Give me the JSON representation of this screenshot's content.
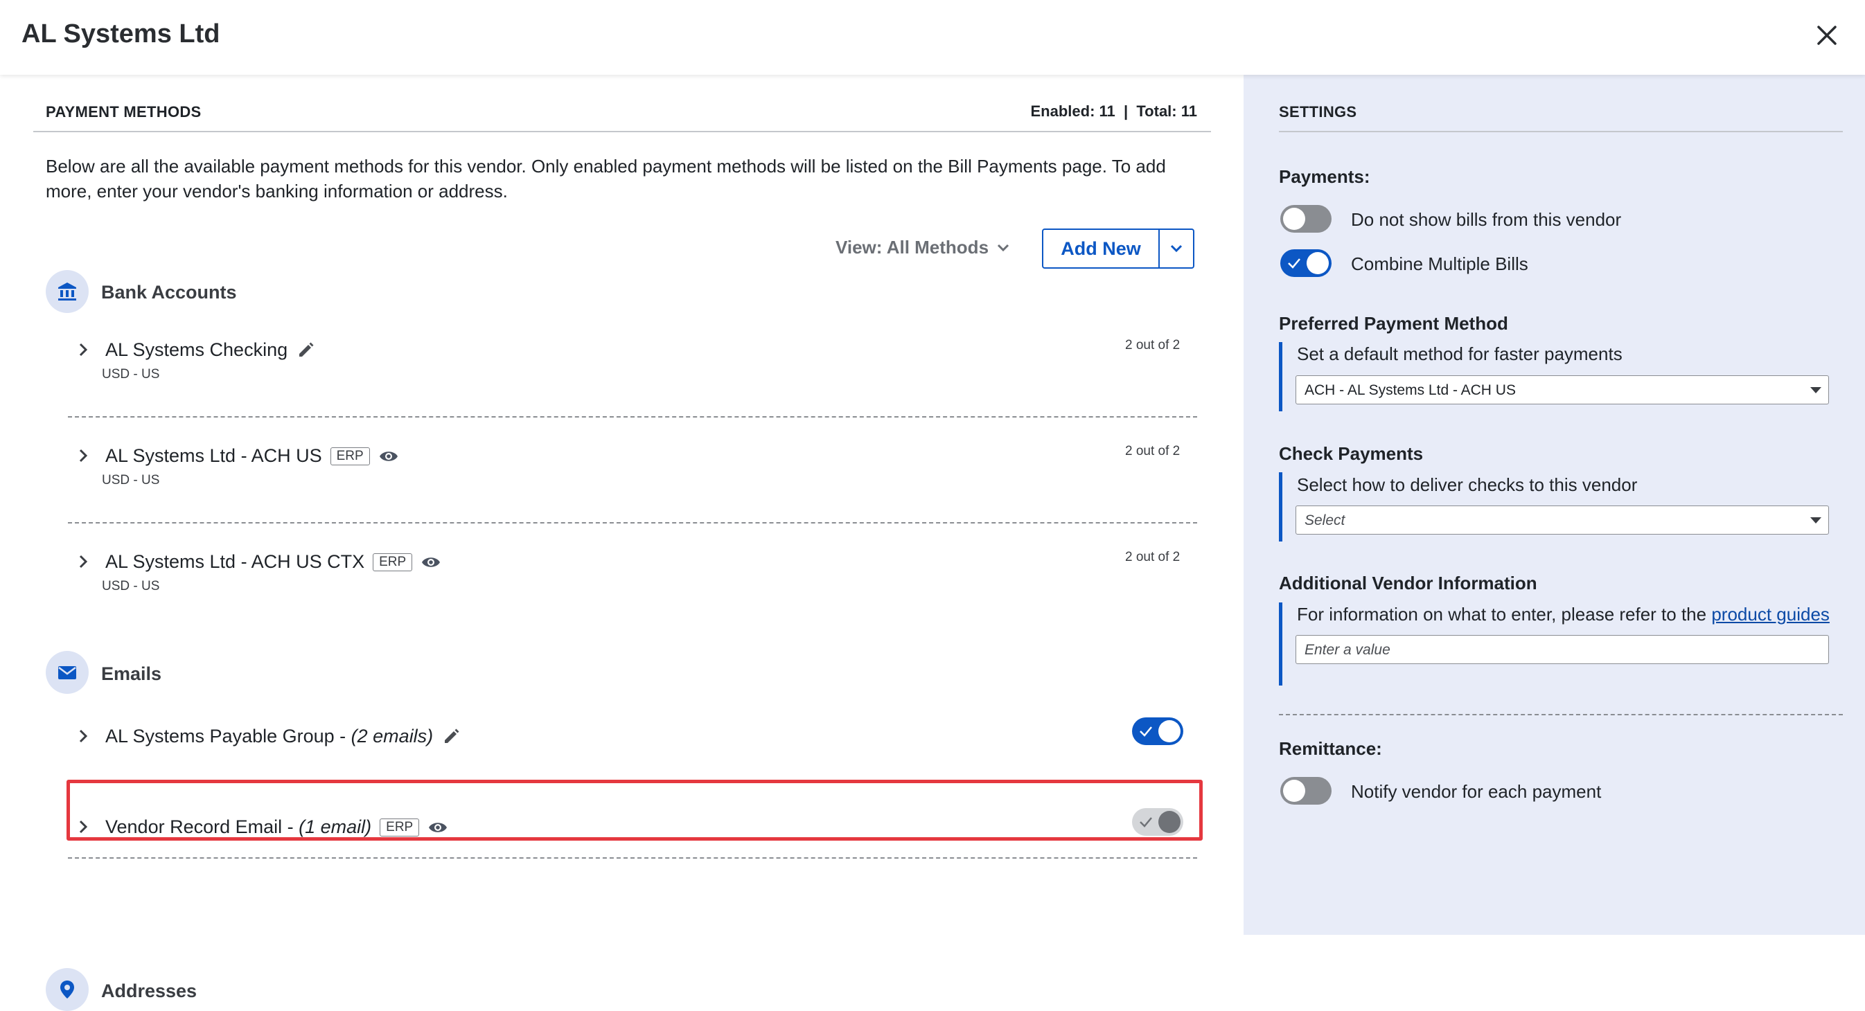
{
  "header": {
    "title": "AL Systems Ltd"
  },
  "payment_methods": {
    "heading": "PAYMENT METHODS",
    "counts": "Enabled: 11  |  Total: 11",
    "description": "Below are all the available payment methods for this vendor. Only enabled payment methods will be listed on the Bill Payments page. To add more, enter your vendor's banking information or address.",
    "view_label": "View: All Methods",
    "add_new_label": "Add New",
    "bank_accounts": {
      "label": "Bank Accounts",
      "items": [
        {
          "name": "AL Systems Checking",
          "sub": "USD - US",
          "count": "2 out of 2"
        },
        {
          "name": "AL Systems Ltd - ACH US",
          "badge": "ERP",
          "sub": "USD - US",
          "count": "2 out of 2"
        },
        {
          "name": "AL Systems Ltd - ACH US CTX",
          "badge": "ERP",
          "sub": "USD - US",
          "count": "2 out of 2"
        }
      ]
    },
    "emails": {
      "label": "Emails",
      "items": [
        {
          "name": "AL Systems Payable Group - ",
          "qualifier": "(2 emails)",
          "enabled": true
        },
        {
          "name": "Vendor Record Email - ",
          "qualifier": "(1 email)",
          "badge": "ERP",
          "enabled": true
        }
      ]
    },
    "addresses": {
      "label": "Addresses"
    }
  },
  "settings": {
    "heading": "SETTINGS",
    "payments_label": "Payments:",
    "do_not_show": {
      "label": "Do not show bills from this vendor",
      "on": false
    },
    "combine": {
      "label": "Combine Multiple Bills",
      "on": true
    },
    "preferred": {
      "heading": "Preferred Payment Method",
      "text": "Set a default method for faster payments",
      "value": "ACH - AL Systems Ltd - ACH US"
    },
    "check": {
      "heading": "Check Payments",
      "text": "Select how to deliver checks to this vendor",
      "placeholder": "Select"
    },
    "additional": {
      "heading": "Additional Vendor Information",
      "text": "For information on what to enter, please refer to the ",
      "link": "product guides",
      "placeholder": "Enter a value"
    },
    "remittance_label": "Remittance:",
    "notify": {
      "label": "Notify vendor for each payment",
      "on": false
    }
  },
  "colors": {
    "accent": "#0c57c4",
    "highlight": "#e5383f",
    "panel": "#e8ecf8"
  },
  "icons": [
    "close-icon",
    "bank-icon",
    "mail-icon",
    "location-pin-icon",
    "chevron-right-icon",
    "chevron-down-icon",
    "pencil-icon",
    "eye-icon",
    "check-icon"
  ]
}
